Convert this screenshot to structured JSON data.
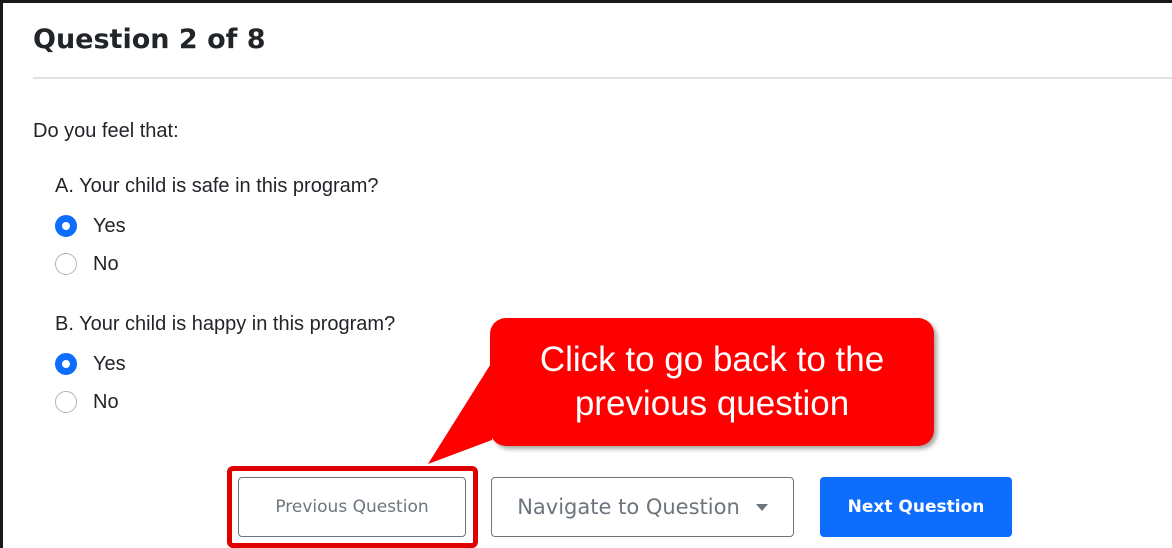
{
  "question_header": "Question 2 of 8",
  "prompt": "Do you feel that:",
  "questions": [
    {
      "text": "A. Your child is safe in this program?",
      "options": [
        {
          "label": "Yes",
          "checked": true
        },
        {
          "label": "No",
          "checked": false
        }
      ]
    },
    {
      "text": "B. Your child is happy in this program?",
      "options": [
        {
          "label": "Yes",
          "checked": true
        },
        {
          "label": "No",
          "checked": false
        }
      ]
    }
  ],
  "buttons": {
    "previous": "Previous Question",
    "navigate": "Navigate to Question",
    "next": "Next Question"
  },
  "callout": "Click to go back to the previous question",
  "colors": {
    "primary": "#0d6efd",
    "callout": "#ff0000",
    "highlight": "#e00000",
    "secondary": "#6c757d"
  },
  "icons": {
    "navigate_caret": "caret-down-icon"
  }
}
